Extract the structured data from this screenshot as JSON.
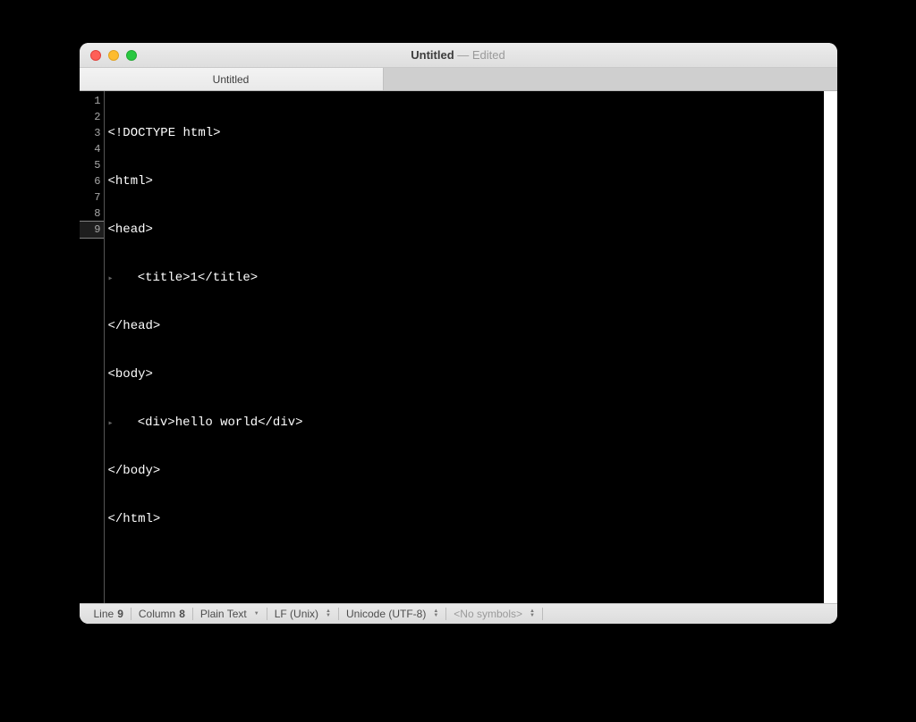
{
  "titlebar": {
    "title": "Untitled",
    "separator": " — ",
    "edited": "Edited"
  },
  "tabs": [
    {
      "label": "Untitled"
    }
  ],
  "editor": {
    "current_line": 9,
    "lines": [
      {
        "num": "1",
        "indent": "",
        "text": "<!DOCTYPE html>"
      },
      {
        "num": "2",
        "indent": "",
        "text": "<html>"
      },
      {
        "num": "3",
        "indent": "",
        "text": "<head>"
      },
      {
        "num": "4",
        "indent": "▸",
        "text": "   <title>1</title>"
      },
      {
        "num": "5",
        "indent": "",
        "text": "</head>"
      },
      {
        "num": "6",
        "indent": "",
        "text": "<body>"
      },
      {
        "num": "7",
        "indent": "▸",
        "text": "   <div>hello world</div>"
      },
      {
        "num": "8",
        "indent": "",
        "text": "</body>"
      },
      {
        "num": "9",
        "indent": "",
        "text": "</html>"
      }
    ]
  },
  "statusbar": {
    "line_label": "Line ",
    "line_value": "9",
    "column_label": "Column ",
    "column_value": "8",
    "syntax": "Plain Text",
    "line_endings": "LF (Unix)",
    "encoding": "Unicode (UTF-8)",
    "symbols": "<No symbols>"
  }
}
